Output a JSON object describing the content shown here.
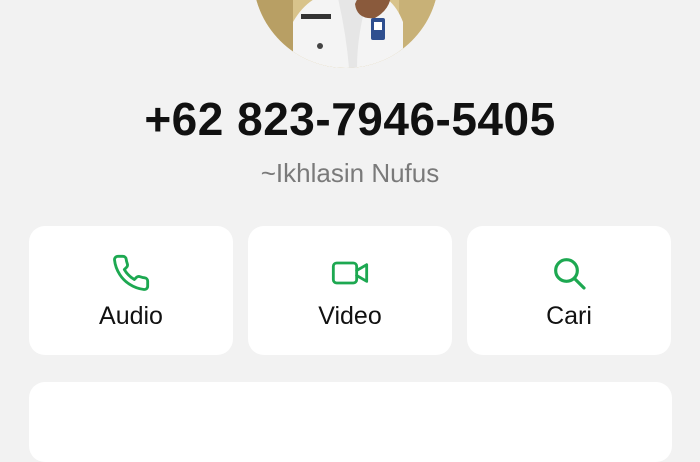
{
  "contact": {
    "phone": "+62 823-7946-5405",
    "profile_name": "~Ikhlasin Nufus"
  },
  "actions": [
    {
      "label": "Audio",
      "icon": "phone-icon"
    },
    {
      "label": "Video",
      "icon": "video-camera-icon"
    },
    {
      "label": "Cari",
      "icon": "search-icon"
    }
  ],
  "colors": {
    "background": "#f2f2f2",
    "card": "#ffffff",
    "accent": "#1da851",
    "primary_text": "#111111",
    "secondary_text": "#7a7a7a"
  }
}
